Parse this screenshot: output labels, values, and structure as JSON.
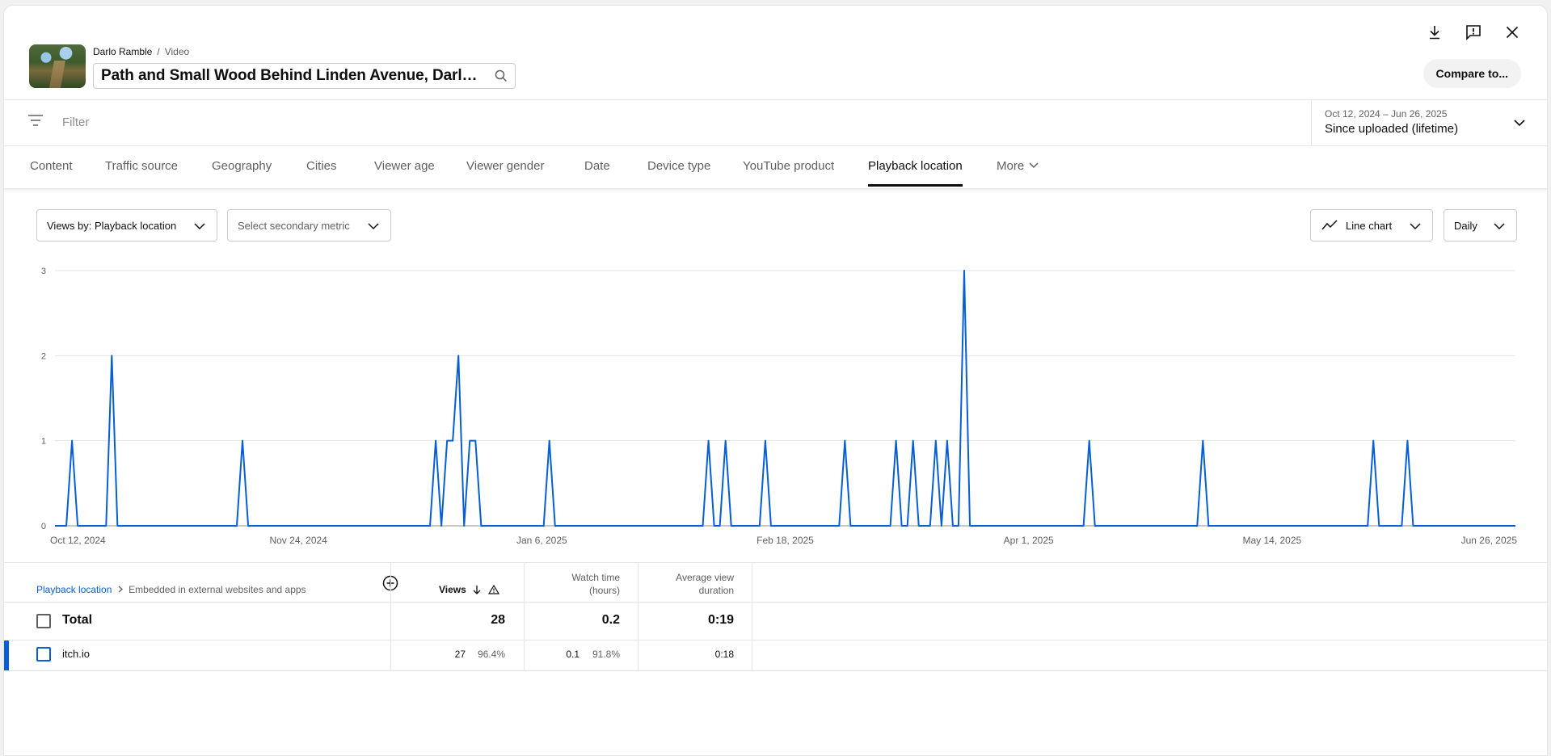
{
  "header": {
    "breadcrumb_channel": "Darlo Ramble",
    "breadcrumb_sep": "/",
    "breadcrumb_page": "Video",
    "title": "Path and Small Wood Behind Linden Avenue, Darlington",
    "compare_label": "Compare to..."
  },
  "filter": {
    "placeholder": "Filter",
    "date_range": "Oct 12, 2024 – Jun 26, 2025",
    "period": "Since uploaded (lifetime)"
  },
  "tabs": [
    {
      "label": "Content"
    },
    {
      "label": "Traffic source"
    },
    {
      "label": "Geography"
    },
    {
      "label": "Cities"
    },
    {
      "label": "Viewer age"
    },
    {
      "label": "Viewer gender"
    },
    {
      "label": "Date"
    },
    {
      "label": "Device type"
    },
    {
      "label": "YouTube product"
    },
    {
      "label": "Playback location",
      "active": true
    },
    {
      "label": "More"
    }
  ],
  "controls": {
    "primary_metric": "Views by: Playback location",
    "secondary_metric": "Select secondary metric",
    "chart_type": "Line chart",
    "interval": "Daily"
  },
  "chart_data": {
    "type": "line",
    "x_start": "2024-10-12",
    "x_end": "2025-06-26",
    "x_ticks": [
      "Oct 12, 2024",
      "Nov 24, 2024",
      "Jan 6, 2025",
      "Feb 18, 2025",
      "Apr 1, 2025",
      "May 14, 2025",
      "Jun 26, 2025"
    ],
    "y_ticks": [
      0,
      1,
      2,
      3
    ],
    "ylim": [
      0,
      3
    ],
    "grid": true,
    "color": "#065fd4",
    "series": [
      {
        "points": [
          {
            "date": "2024-10-15",
            "value": 1
          },
          {
            "date": "2024-10-22",
            "value": 2
          },
          {
            "date": "2024-11-14",
            "value": 1
          },
          {
            "date": "2024-12-18",
            "value": 1
          },
          {
            "date": "2024-12-20",
            "value": 1
          },
          {
            "date": "2024-12-21",
            "value": 1
          },
          {
            "date": "2024-12-22",
            "value": 2
          },
          {
            "date": "2024-12-24",
            "value": 1
          },
          {
            "date": "2024-12-25",
            "value": 1
          },
          {
            "date": "2025-01-07",
            "value": 1
          },
          {
            "date": "2025-02-04",
            "value": 1
          },
          {
            "date": "2025-02-07",
            "value": 1
          },
          {
            "date": "2025-02-14",
            "value": 1
          },
          {
            "date": "2025-02-28",
            "value": 1
          },
          {
            "date": "2025-03-09",
            "value": 1
          },
          {
            "date": "2025-03-12",
            "value": 1
          },
          {
            "date": "2025-03-16",
            "value": 1
          },
          {
            "date": "2025-03-18",
            "value": 1
          },
          {
            "date": "2025-03-21",
            "value": 3
          },
          {
            "date": "2025-04-12",
            "value": 1
          },
          {
            "date": "2025-05-02",
            "value": 1
          },
          {
            "date": "2025-06-01",
            "value": 1
          },
          {
            "date": "2025-06-07",
            "value": 1
          }
        ]
      }
    ]
  },
  "table": {
    "breadcrumb_link": "Playback location",
    "breadcrumb_current": "Embedded in external websites and apps",
    "columns": {
      "views": "Views",
      "watch_time_1": "Watch time",
      "watch_time_2": "(hours)",
      "avg_duration_1": "Average view",
      "avg_duration_2": "duration"
    },
    "total": {
      "label": "Total",
      "views": "28",
      "watch_time": "0.2",
      "avg_duration": "0:19"
    },
    "rows": [
      {
        "label": "itch.io",
        "views": "27",
        "views_pct": "96.4%",
        "watch_time": "0.1",
        "watch_time_pct": "91.8%",
        "avg_duration": "0:18"
      }
    ]
  }
}
